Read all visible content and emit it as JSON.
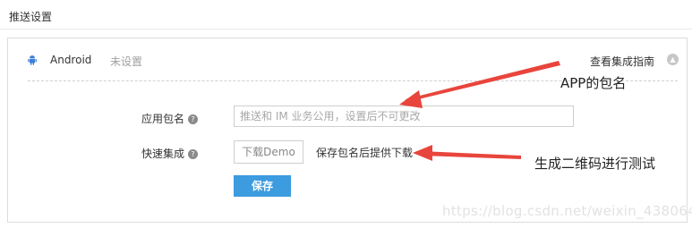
{
  "header": {
    "title": "推送设置"
  },
  "platform": {
    "name": "Android",
    "status": "未设置",
    "guide_label": "查看集成指南",
    "collapse_icon": "chevron-up-icon"
  },
  "form": {
    "package_label": "应用包名",
    "package_help": "?",
    "package_placeholder": "推送和 IM 业务公用，设置后不可更改",
    "integration_label": "快速集成",
    "integration_help": "?",
    "demo_button": "下载Demo",
    "demo_hint": "保存包名后提供下载",
    "save_button": "保存"
  },
  "annotations": {
    "package_note": "APP的包名",
    "qrcode_note": "生成二维码进行测试",
    "arrow_color": "#e8453c"
  },
  "watermark": "https://blog.csdn.net/weixin_43806483",
  "colors": {
    "primary": "#3d9be0",
    "border": "#dcdcdc",
    "muted": "#a0a0a0"
  }
}
